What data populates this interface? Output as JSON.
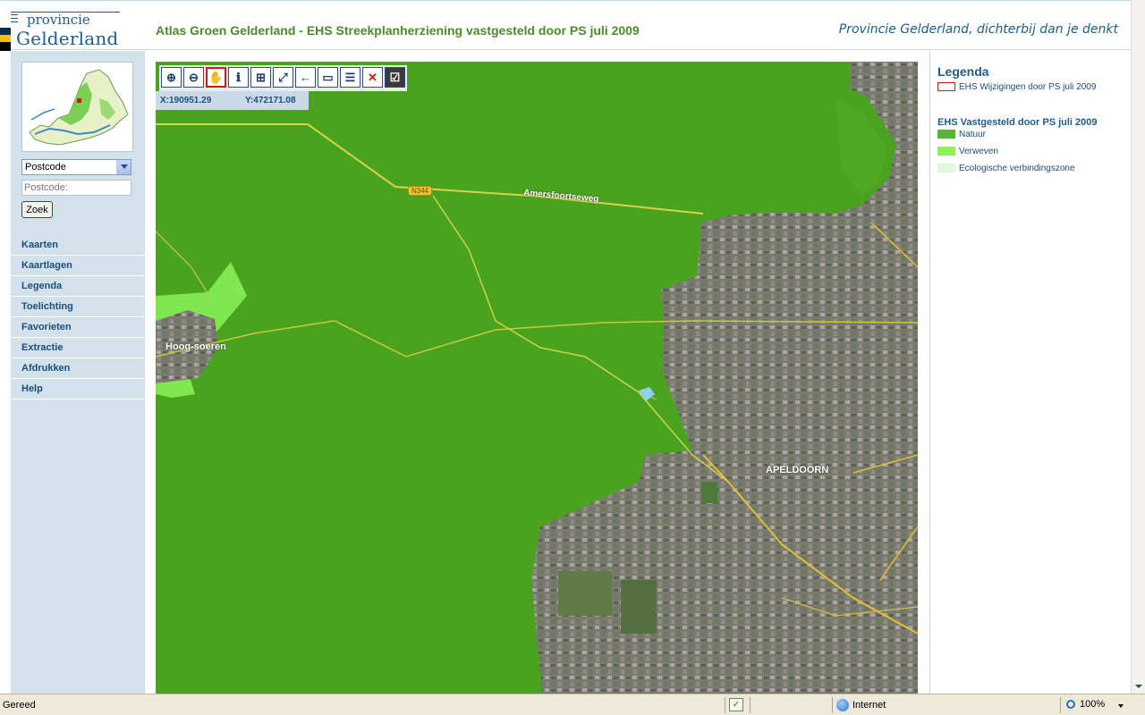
{
  "header": {
    "logo_top": "provincie",
    "logo_bottom": "Gelderland",
    "title": "Atlas Groen Gelderland - EHS Streekplanherziening vastgesteld door PS juli 2009",
    "slogan": "Provincie Gelderland, dichterbij dan je denkt"
  },
  "sidebar": {
    "search_type_selected": "Postcode",
    "postcode_placeholder": "Postcode:",
    "search_button": "Zoek",
    "nav_items": [
      "Kaarten",
      "Kaartlagen",
      "Legenda",
      "Toelichting",
      "Favorieten",
      "Extractie",
      "Afdrukken",
      "Help"
    ]
  },
  "map": {
    "tools": [
      {
        "icon": "zoom-in-icon",
        "glyph": "⊕"
      },
      {
        "icon": "zoom-out-icon",
        "glyph": "⊖"
      },
      {
        "icon": "pan-hand-icon",
        "glyph": "✋",
        "active": true
      },
      {
        "icon": "info-icon",
        "glyph": "ℹ"
      },
      {
        "icon": "measure-icon",
        "glyph": "⊞"
      },
      {
        "icon": "full-extent-icon",
        "glyph": "⤢"
      },
      {
        "icon": "back-arrow-icon",
        "glyph": "←"
      },
      {
        "icon": "rectangle-select-icon",
        "glyph": "▭"
      },
      {
        "icon": "list-icon",
        "glyph": "☰"
      },
      {
        "icon": "clear-icon",
        "glyph": "✕"
      },
      {
        "icon": "checkbox-icon",
        "glyph": "☑"
      }
    ],
    "coord_x": "X:190951.29",
    "coord_y": "Y:472171.08",
    "labels": {
      "road": "Amersfoortseweg",
      "road_number": "N344",
      "village": "Hoog-soeren",
      "city": "APELDOORN"
    }
  },
  "legend": {
    "title": "Legenda",
    "change_item": "EHS Wijzigingen door PS juli 2009",
    "change_color": "#d01818",
    "group_title": "EHS Vastgesteld door PS juli 2009",
    "items": [
      {
        "label": "Natuur",
        "color": "#58b336"
      },
      {
        "label": "Verweven",
        "color": "#8ef05a"
      },
      {
        "label": "Ecologische verbindingszone",
        "color": "#e2f8dc"
      }
    ]
  },
  "statusbar": {
    "status": "Gereed",
    "zone": "Internet",
    "zoom": "100%"
  }
}
